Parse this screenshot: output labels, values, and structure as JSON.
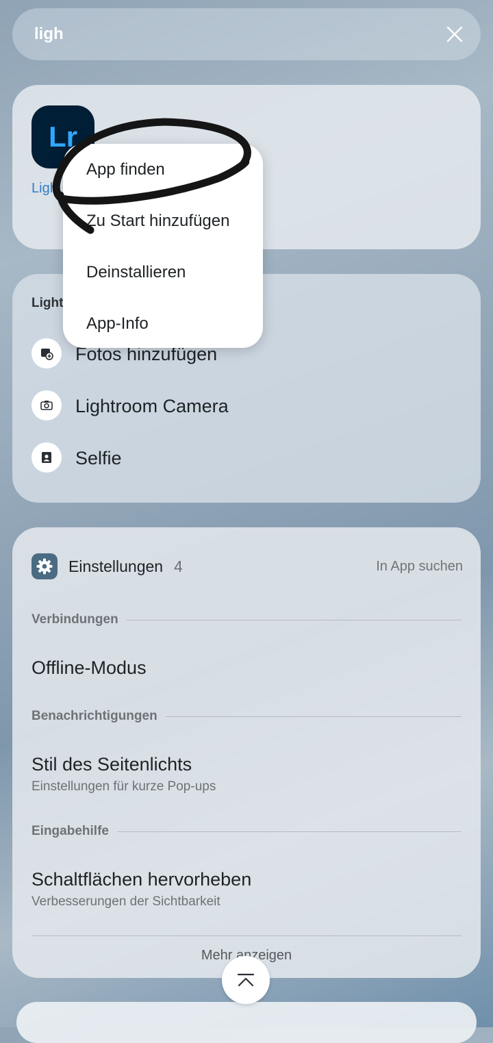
{
  "search": {
    "query": "ligh"
  },
  "app_result": {
    "icon_text": "Lr",
    "label": "Lightroom"
  },
  "shortcuts": {
    "title": "Lightroom",
    "items": [
      {
        "label": "Fotos hinzufügen",
        "icon": "add-photo-icon"
      },
      {
        "label": "Lightroom Camera",
        "icon": "camera-icon"
      },
      {
        "label": "Selfie",
        "icon": "portrait-icon"
      }
    ]
  },
  "settings": {
    "title": "Einstellungen",
    "count": "4",
    "in_app_search": "In App suchen",
    "sections": [
      {
        "header": "Verbindungen",
        "title": "Offline-Modus",
        "subtitle": ""
      },
      {
        "header": "Benachrichtigungen",
        "title": "Stil des Seitenlichts",
        "subtitle": "Einstellungen für kurze Pop-ups"
      },
      {
        "header": "Eingabehilfe",
        "title": "Schaltflächen hervorheben",
        "subtitle": "Verbesserungen der Sichtbarkeit"
      }
    ],
    "more": "Mehr anzeigen"
  },
  "context_menu": {
    "items": [
      "App finden",
      "Zu Start hinzufügen",
      "Deinstallieren",
      "App-Info"
    ]
  },
  "colors": {
    "lightroom_bg": "#001e36",
    "lightroom_fg": "#31a8ff",
    "settings_icon_bg": "#4b6b82",
    "annotation_stroke": "#151515"
  }
}
